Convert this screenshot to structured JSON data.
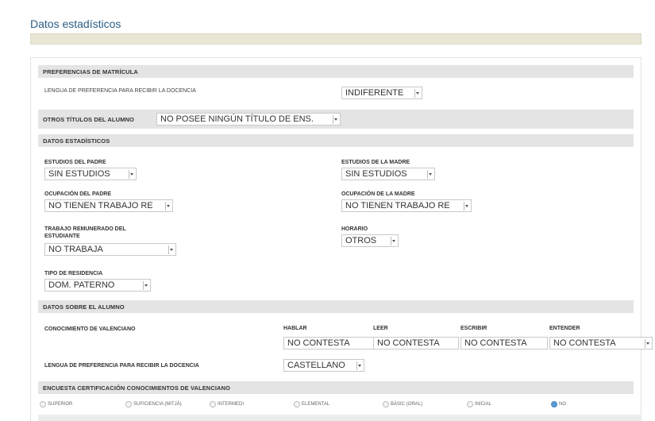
{
  "page": {
    "title": "Datos estadísticos"
  },
  "matricula": {
    "header": "PREFERENCIAS DE MATRÍCULA",
    "lengua_label": "LENGUA DE PREFERENCIA PARA RECIBIR LA DOCENCIA",
    "lengua_value": "INDIFERENTE"
  },
  "otros": {
    "label": "OTROS TÍTULOS DEL ALUMNO",
    "value": "NO POSEE NINGÚN TÍTULO DE ENS."
  },
  "estadisticos": {
    "header": "DATOS ESTADÍSTICOS",
    "estudios_padre_label": "ESTUDIOS DEL PADRE",
    "estudios_padre_value": "SIN ESTUDIOS",
    "estudios_madre_label": "ESTUDIOS DE LA MADRE",
    "estudios_madre_value": "SIN ESTUDIOS",
    "ocupacion_padre_label": "OCUPACIÓN DEL PADRE",
    "ocupacion_padre_value": "NO TIENEN TRABAJO RE",
    "ocupacion_madre_label": "OCUPACIÓN DE LA MADRE",
    "ocupacion_madre_value": "NO TIENEN TRABAJO RE",
    "trabajo_label_1": "TRABAJO REMUNERADO DEL",
    "trabajo_label_2": "ESTUDIANTE",
    "trabajo_value": "NO TRABAJA",
    "horario_label": "HORARIO",
    "horario_value": "OTROS",
    "residencia_label": "TIPO DE RESIDENCIA",
    "residencia_value": "DOM. PATERNO"
  },
  "alumno": {
    "header": "DATOS SOBRE EL ALUMNO",
    "conocimiento_label": "CONOCIMIENTO DE VALENCIANO",
    "hablar_label": "HABLAR",
    "hablar_value": "NO CONTESTA",
    "leer_label": "LEER",
    "leer_value": "NO CONTESTA",
    "escribir_label": "ESCRIBIR",
    "escribir_value": "NO CONTESTA",
    "entender_label": "ENTENDER",
    "entender_value": "NO CONTESTA",
    "lengua_label": "LENGUA DE PREFERENCIA PARA RECIBIR LA DOCENCIA",
    "lengua_value": "CASTELLANO"
  },
  "encuesta": {
    "header": "ENCUESTA CERTIFICACIÓN CONOCIMIENTOS DE VALENCIANO",
    "options": [
      "SUPERIOR",
      "SUFICIENCIA (MITJÀ)",
      "INTERMEDI",
      "ELEMENTAL",
      "BÀSIC (ORAL)",
      "INICIAL",
      "NO"
    ],
    "selected": "NO"
  },
  "colors": {
    "title": "#2c5d86",
    "section_bg": "#e4e4e4",
    "bar": "#e9e6d6",
    "radio_selected": "#5b9bd5"
  }
}
